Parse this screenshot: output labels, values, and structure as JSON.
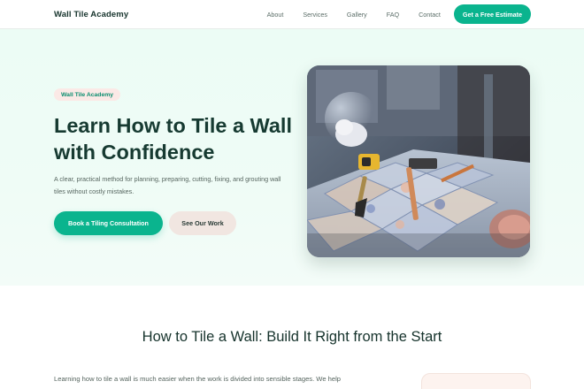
{
  "brand": "Wall Tile Academy",
  "nav": {
    "links": [
      "About",
      "Services",
      "Gallery",
      "FAQ",
      "Contact"
    ],
    "cta": "Get a Free Estimate"
  },
  "hero": {
    "badge": "Wall Tile Academy",
    "title": "Learn How to Tile a Wall with Confidence",
    "description": "A clear, practical method for planning, preparing, cutting, fixing, and grouting wall tiles without costly mistakes.",
    "primary_button": "Book a Tiling Consultation",
    "secondary_button": "See Our Work",
    "image_icon": "tiling-tools-photo"
  },
  "section": {
    "title": "How to Tile a Wall: Build It Right from the Start",
    "paragraph": "Learning how to tile a wall is much easier when the work is divided into sensible stages. We help"
  },
  "colors": {
    "accent": "#0ab48e",
    "hero_bg": "#ecfcf5",
    "heading": "#163a31",
    "badge_bg": "#fbe9e6",
    "secondary_btn_bg": "#f1e6e1"
  }
}
